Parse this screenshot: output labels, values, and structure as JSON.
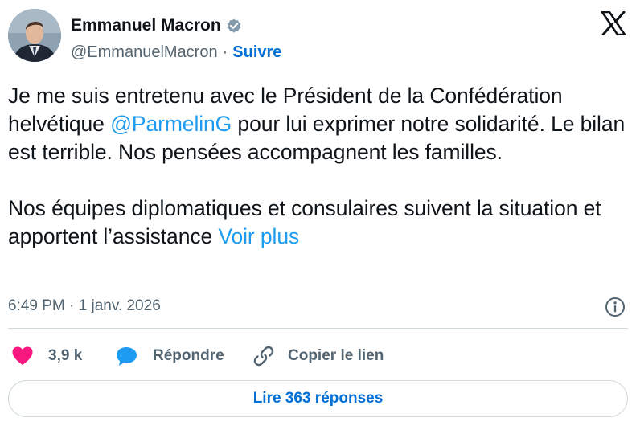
{
  "author": {
    "name": "Emmanuel Macron",
    "handle": "@EmmanuelMacron",
    "separator": "·",
    "follow_label": "Suivre"
  },
  "tweet": {
    "para1_before": "Je me suis entretenu avec le Président de la Confédération helvétique ",
    "mention": "@ParmelinG",
    "para1_after": " pour lui exprimer notre solidarité. Le bilan est terrible. Nos pensées accompagnent les familles.",
    "para2": "Nos équipes diplomatiques et consulaires suivent la situation et apportent l’assistance ",
    "more_label": "Voir plus"
  },
  "timestamp": "6:49 PM · 1 janv. 2026",
  "actions": {
    "likes": "3,9 k",
    "reply_label": "Répondre",
    "copy_label": "Copier le lien"
  },
  "replies_button": "Lire 363 réponses",
  "colors": {
    "like": "#f91880",
    "accent": "#1d9bf0",
    "link_blue": "#006fd6",
    "muted": "#536471",
    "border": "#cfd9de"
  },
  "icons": [
    "avatar",
    "verified-badge-icon",
    "x-logo-icon",
    "info-icon",
    "heart-icon",
    "reply-bubble-icon",
    "link-icon"
  ]
}
